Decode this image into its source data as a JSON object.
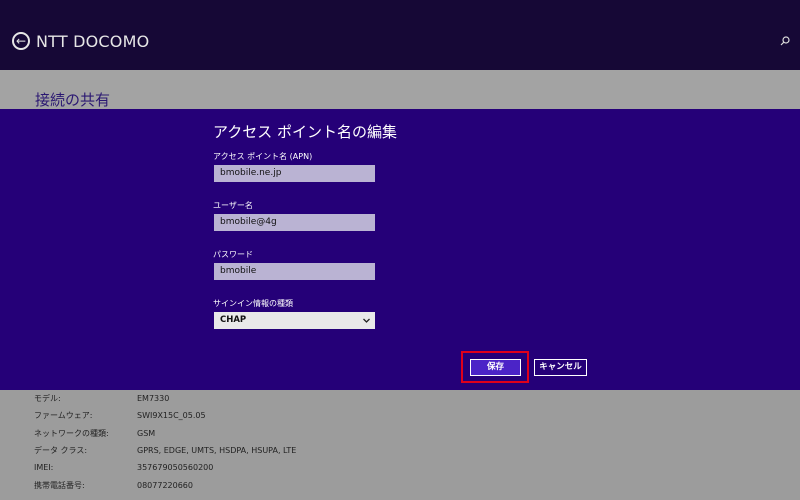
{
  "header": {
    "back_icon": "back-arrow-icon",
    "title": "NTT DOCOMO",
    "search_icon": "search-icon"
  },
  "section": {
    "title": "接続の共有"
  },
  "dialog": {
    "title": "アクセス ポイント名の編集",
    "apn": {
      "label": "アクセス ポイント名 (APN)",
      "value": "bmobile.ne.jp"
    },
    "user": {
      "label": "ユーザー名",
      "value": "bmobile@4g"
    },
    "password": {
      "label": "パスワード",
      "value": "bmobile"
    },
    "signin": {
      "label": "サインイン情報の種類",
      "selected": "CHAP"
    },
    "save_label": "保存",
    "cancel_label": "キャンセル"
  },
  "info": [
    {
      "key": "モデル:",
      "value": "EM7330"
    },
    {
      "key": "ファームウェア:",
      "value": "SWI9X15C_05.05"
    },
    {
      "key": "ネットワークの種類:",
      "value": "GSM"
    },
    {
      "key": "データ クラス:",
      "value": "GPRS, EDGE, UMTS, HSDPA, HSUPA, LTE"
    },
    {
      "key": "IMEI:",
      "value": "357679050560200"
    },
    {
      "key": "携帯電話番号:",
      "value": "08077220660"
    }
  ],
  "colors": {
    "header_bg": "#160836",
    "dialog_bg": "#250078",
    "accent": "#4b24c7",
    "highlight": "#e0001a"
  }
}
